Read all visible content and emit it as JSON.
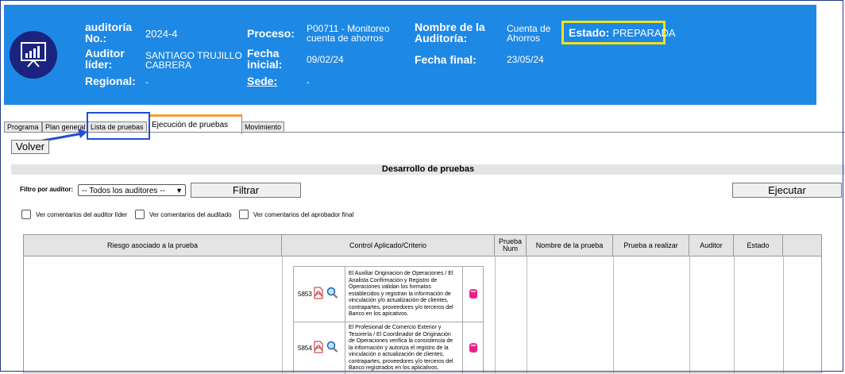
{
  "header": {
    "audit_no_label": "auditoría No.:",
    "audit_no": "2024-4",
    "lead_label": "Auditor líder:",
    "lead": "SANTIAGO TRUJILLO CABRERA",
    "regional_label": "Regional:",
    "regional": "-",
    "proceso_label": "Proceso:",
    "proceso": "P00711 - Monitoreo cuenta de ahorros",
    "fecha_inicial_label": "Fecha inicial:",
    "fecha_inicial": "09/02/24",
    "sede_label": "Sede:",
    "sede": "-",
    "nombre_label": "Nombre de la Auditoría:",
    "nombre": "Cuenta de Ahorros",
    "fecha_final_label": "Fecha final:",
    "fecha_final": "23/05/24",
    "estado_label": "Estado:",
    "estado": "PREPARADA",
    "logo_icon": "presentation-chart-icon"
  },
  "tabs": [
    "Programa",
    "Plan general",
    "Lista de pruebas",
    "Ejecución de pruebas",
    "Movimiento"
  ],
  "active_tab": "Ejecución de pruebas",
  "volver_label": "Volver",
  "section_title": "Desarrollo de pruebas",
  "filter": {
    "label": "Filtro por auditor:",
    "selected": "-- Todos los auditores --",
    "filtrar_label": "Filtrar",
    "ejecutar_label": "Ejecutar"
  },
  "checkboxes": [
    "Ver comentarios del auditor líder",
    "Ver comentarios del auditado",
    "Ver comentarios del aprobador final"
  ],
  "table": {
    "headers": [
      "Riesgo asociado a la prueba",
      "Control Aplicado/Criterio",
      "Prueba Num",
      "Nombre de la prueba",
      "Prueba a realizar",
      "Auditor",
      "Estado"
    ],
    "controls": [
      {
        "num": "5853",
        "text": "El Auxiliar Originacion de Operaciones / El Analista Confirmación y Registro de Operaciones validan los formatos establecidos y registran la información de vinculación y/o actualización de clientes, contrapartes, proveedores y/o terceros del Banco en los apicativos."
      },
      {
        "num": "5854",
        "text": "El Profesional de Comercio Exterior y Tesorería / El Coordinador de Originación de Operaciones verifica la consistencia de la información y autoriza el registro de la vinculación o actualización de clientes, contrapartes, proveedores y/o terceros del Banco registrados en los aplicativos."
      }
    ]
  },
  "colors": {
    "header_bg": "#1e88e5",
    "logo_bg": "#1a237e",
    "estado_border": "#f2e11a",
    "annotation_blue": "#1e4fd6",
    "active_tab_accent": "#f0a030"
  }
}
